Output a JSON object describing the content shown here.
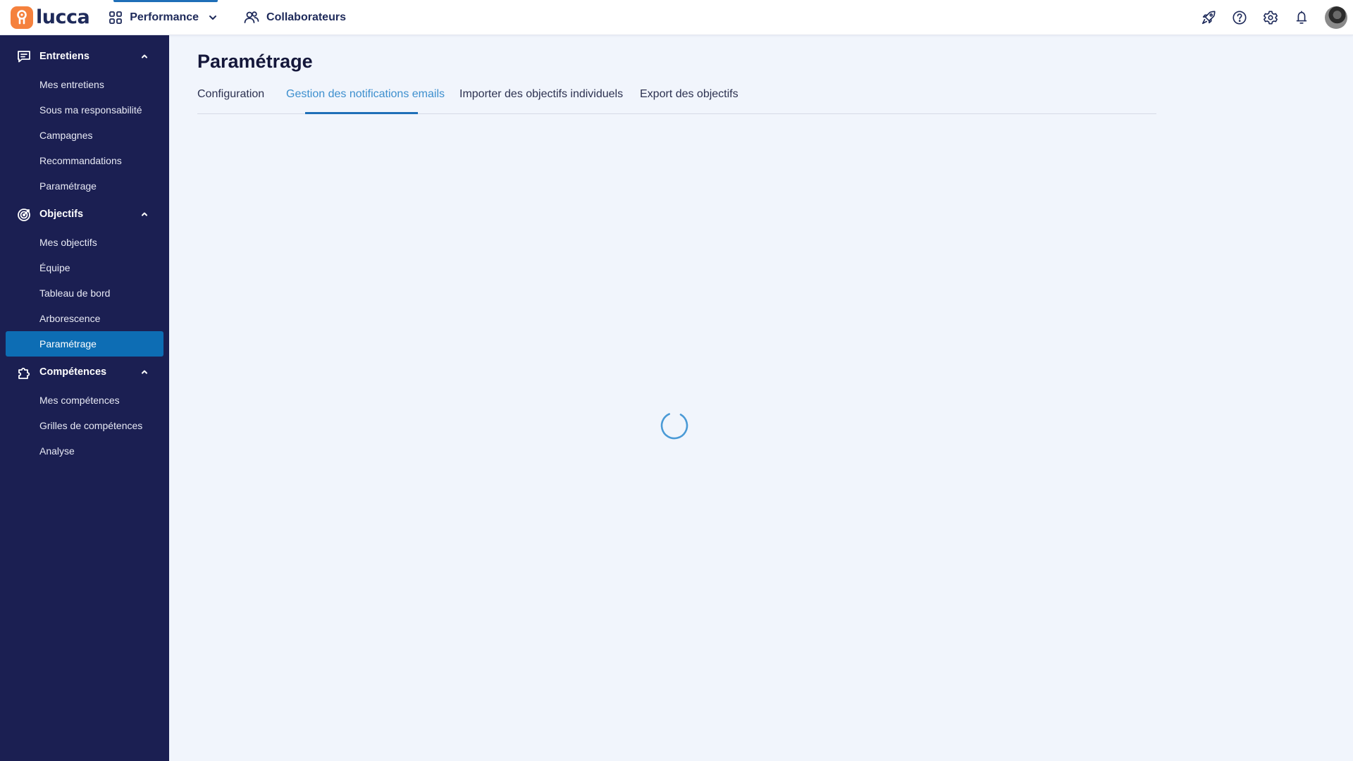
{
  "app": {
    "logo_text": "lucca",
    "nav": {
      "performance_label": "Performance",
      "collaborateurs_label": "Collaborateurs"
    }
  },
  "sidebar": {
    "sections": [
      {
        "label": "Entretiens",
        "icon": "chat-icon",
        "items": [
          "Mes entretiens",
          "Sous ma responsabilité",
          "Campagnes",
          "Recommandations",
          "Paramétrage"
        ]
      },
      {
        "label": "Objectifs",
        "icon": "target-icon",
        "items": [
          "Mes objectifs",
          "Équipe",
          "Tableau de bord",
          "Arborescence",
          "Paramétrage"
        ]
      },
      {
        "label": "Compétences",
        "icon": "puzzle-icon",
        "items": [
          "Mes compétences",
          "Grilles de compétences",
          "Analyse"
        ]
      }
    ],
    "active_item": "Objectifs / Paramétrage"
  },
  "main": {
    "title": "Paramétrage",
    "tabs": [
      {
        "label": "Configuration",
        "active": false
      },
      {
        "label": "Gestion des notifications emails",
        "active": true
      },
      {
        "label": "Importer des objectifs individuels",
        "active": false
      },
      {
        "label": "Export des objectifs",
        "active": false
      }
    ],
    "loading": true
  },
  "icons": {
    "top_actions": [
      "rocket-icon",
      "help-icon",
      "settings-icon",
      "bell-icon"
    ]
  },
  "colors": {
    "sidebar_bg": "#1b1f52",
    "accent": "#1f6fb8",
    "active_item_bg": "#0d6db4",
    "active_tab_text": "#3d8fce",
    "logo_orange": "#f5813d",
    "page_bg": "#f1f5fc"
  }
}
